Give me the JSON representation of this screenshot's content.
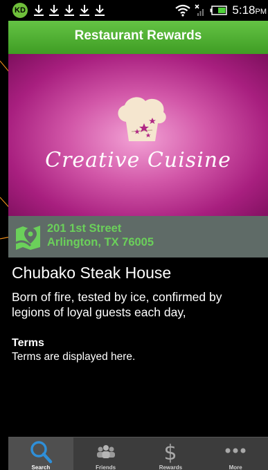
{
  "status_bar": {
    "app_badge": "KD",
    "time": "5:18",
    "ampm": "PM"
  },
  "header": {
    "title": "Restaurant Rewards"
  },
  "banner": {
    "brand_text": "Creative Cuisine"
  },
  "address": {
    "line1": "201 1st Street",
    "line2": "Arlington, TX 76005"
  },
  "restaurant": {
    "name": "Chubako Steak House",
    "description_line1": "Born of fire, tested by ice, confirmed by",
    "description_line2": "legions of loyal guests each day,",
    "terms_heading": "Terms",
    "terms_text": "Terms are displayed here."
  },
  "tabs": [
    {
      "label": "Search",
      "icon": "search-icon",
      "active": true
    },
    {
      "label": "Friends",
      "icon": "friends-icon",
      "active": false
    },
    {
      "label": "Rewards",
      "icon": "dollar-icon",
      "active": false
    },
    {
      "label": "More",
      "icon": "more-icon",
      "active": false
    }
  ],
  "colors": {
    "green_header": "#4fae30",
    "address_text": "#6bd05a",
    "annotation": "#e8891a",
    "banner_magenta": "#b02884"
  }
}
